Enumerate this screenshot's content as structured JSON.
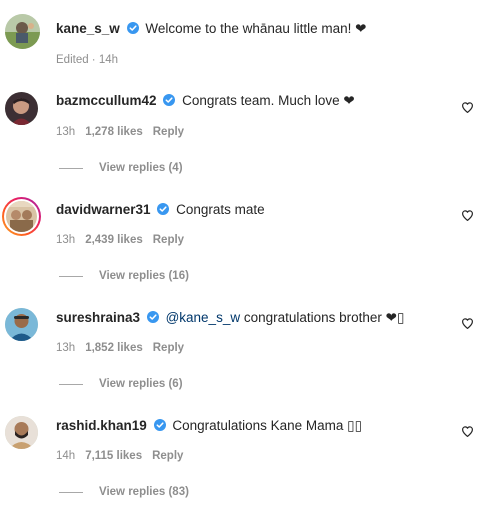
{
  "caption": {
    "username": "kane_s_w",
    "text": "Welcome to the whānau little man! ❤",
    "edited": "Edited",
    "time": "14h"
  },
  "comments": [
    {
      "username": "bazmccullum42",
      "text": "Congrats team. Much love ❤",
      "mention": "",
      "time": "13h",
      "likes": "1,278 likes",
      "reply_label": "Reply",
      "view_replies": "View replies (4)"
    },
    {
      "username": "davidwarner31",
      "text": "Congrats mate",
      "mention": "",
      "time": "13h",
      "likes": "2,439 likes",
      "reply_label": "Reply",
      "view_replies": "View replies (16)"
    },
    {
      "username": "sureshraina3",
      "text": " congratulations brother ❤▯",
      "mention": "@kane_s_w",
      "time": "13h",
      "likes": "1,852 likes",
      "reply_label": "Reply",
      "view_replies": "View replies (6)"
    },
    {
      "username": "rashid.khan19",
      "text": "Congratulations Kane Mama ▯▯",
      "mention": "",
      "time": "14h",
      "likes": "7,115 likes",
      "reply_label": "Reply",
      "view_replies": "View replies (83)"
    }
  ],
  "icons": {
    "verified": "verified-badge-icon",
    "like": "heart-outline-icon"
  },
  "colors": {
    "verified": "#3897f0",
    "secondary_text": "#8e8e8e",
    "mention": "#00376b",
    "primary_text": "#262626"
  }
}
